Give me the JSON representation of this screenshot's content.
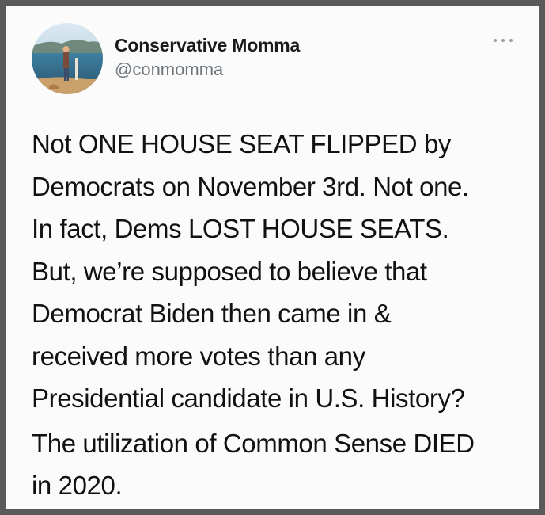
{
  "tweet": {
    "author": {
      "display_name": "Conservative Momma",
      "handle": "@conmomma",
      "avatar_icon": "profile-photo"
    },
    "more_icon": "ellipsis-icon",
    "paragraphs": [
      {
        "lines": [
          "Not ONE HOUSE SEAT FLIPPED by",
          "Democrats on November 3rd. Not one.",
          "In fact, Dems LOST HOUSE SEATS.",
          "But, we’re supposed to believe that",
          "Democrat Biden then came in &",
          "received more votes than any",
          "Presidential candidate in U.S. History?"
        ]
      },
      {
        "lines": [
          "The utilization of Common Sense DIED",
          "in 2020."
        ]
      }
    ]
  },
  "colors": {
    "background_frame": "#5a5a5a",
    "card": "#fbfbfb",
    "text": "#111111",
    "handle": "#6e767d"
  }
}
